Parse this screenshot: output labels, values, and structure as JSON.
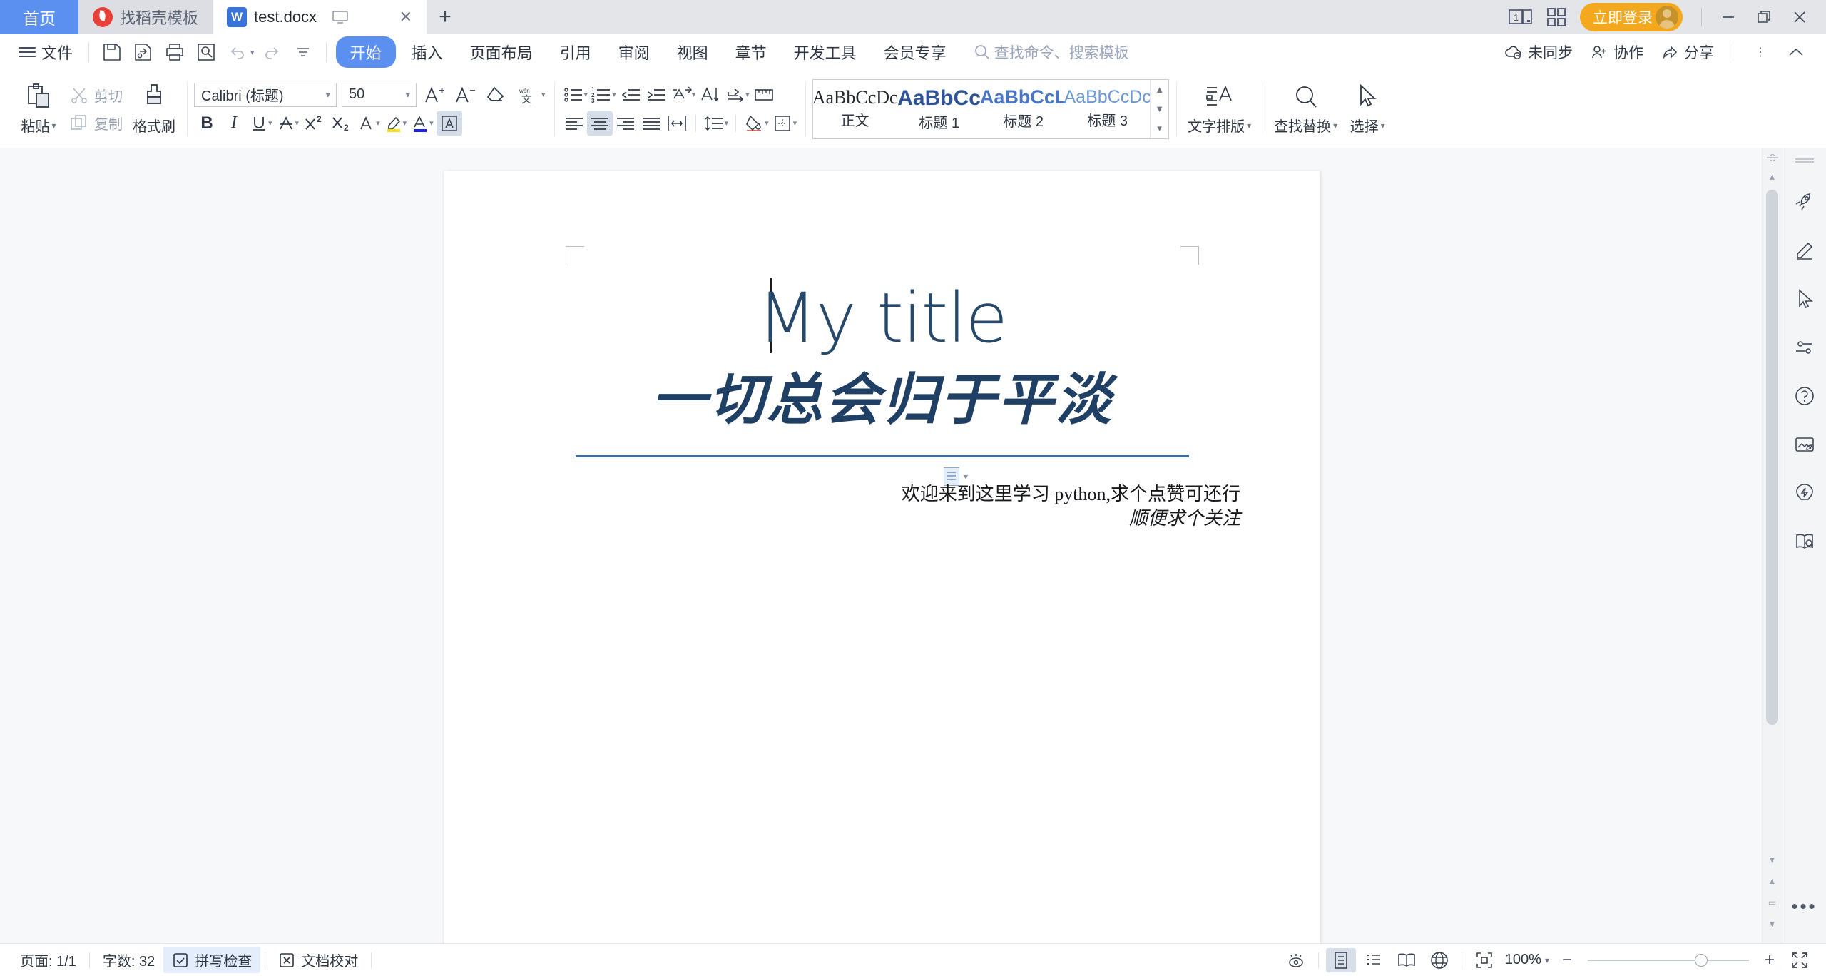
{
  "window": {
    "tabs": [
      {
        "label": "首页",
        "icon": "home-tab",
        "type": "home"
      },
      {
        "label": "找稻壳模板",
        "icon": "daoke-icon",
        "type": "inactive"
      },
      {
        "label": "test.docx",
        "icon": "wps-writer-icon",
        "type": "active"
      }
    ],
    "new_tab_label": "+",
    "close_label": "✕",
    "login_label": "立即登录",
    "minimize_label": "—",
    "restore_label": "❐",
    "close_window_label": "✕"
  },
  "menubar": {
    "file_label": "文件",
    "quick_icons": [
      "save-icon",
      "save-as-icon",
      "print-icon",
      "print-preview-icon",
      "undo-icon",
      "redo-icon",
      "customize-icon"
    ],
    "tabs": [
      {
        "label": "开始",
        "active": true
      },
      {
        "label": "插入",
        "active": false
      },
      {
        "label": "页面布局",
        "active": false
      },
      {
        "label": "引用",
        "active": false
      },
      {
        "label": "审阅",
        "active": false
      },
      {
        "label": "视图",
        "active": false
      },
      {
        "label": "章节",
        "active": false
      },
      {
        "label": "开发工具",
        "active": false
      },
      {
        "label": "会员专享",
        "active": false
      }
    ],
    "search_placeholder": "查找命令、搜索模板",
    "right_items": [
      {
        "label": "未同步",
        "icon": "cloud-sync-icon"
      },
      {
        "label": "协作",
        "icon": "collaborate-icon"
      },
      {
        "label": "分享",
        "icon": "share-icon"
      }
    ],
    "more_label": "⋮",
    "collapse_label": "⌃"
  },
  "ribbon": {
    "clipboard": {
      "paste_label": "粘贴",
      "cut_label": "剪切",
      "copy_label": "复制",
      "format_painter_label": "格式刷"
    },
    "font": {
      "family_value": "Calibri (标题)",
      "size_value": "50",
      "grow_label": "A+",
      "shrink_label": "A−",
      "clear_format_label": "clear-format-icon",
      "phonetic_label": "拼音指南",
      "bold_label": "B",
      "italic_label": "I",
      "underline_label": "U",
      "strikethrough_label": "A",
      "superscript_label": "X²",
      "subscript_label": "X₂",
      "text_effects_label": "A",
      "highlight_label": "A",
      "font_color_label": "A",
      "char_border_label": "A"
    },
    "paragraph": {
      "bullets_label": "项目符号",
      "numbering_label": "编号",
      "decrease_indent_label": "减少缩进",
      "increase_indent_label": "增加缩进",
      "asian_layout_label": "中文版式",
      "sort_label": "排序",
      "show_marks_label": "显示/隐藏编辑标记",
      "ruler_label": "标尺",
      "align_left_label": "左对齐",
      "align_center_label": "居中对齐",
      "align_right_label": "右对齐",
      "align_justify_label": "两端对齐",
      "distribute_label": "分散对齐",
      "line_spacing_label": "行距",
      "shading_label": "底纹",
      "borders_label": "边框"
    },
    "styles": {
      "items": [
        {
          "sample": "AaBbCcDc",
          "name": "正文",
          "color": "#24292f",
          "weight": "normal",
          "family": "serif",
          "size": "25px"
        },
        {
          "sample": "AaBbCc",
          "name": "标题 1",
          "color": "#2f5496",
          "weight": "bold",
          "family": "sans",
          "size": "30px"
        },
        {
          "sample": "AaBbCcL",
          "name": "标题 2",
          "color": "#4a76c4",
          "weight": "bold",
          "family": "sans",
          "size": "27px"
        },
        {
          "sample": "AaBbCcDc",
          "name": "标题 3",
          "color": "#6d98d6",
          "weight": "normal",
          "family": "sans",
          "size": "25px"
        }
      ],
      "scroll_up": "▲",
      "scroll_down": "▼",
      "scroll_more": "▾"
    },
    "tools": [
      {
        "label": "文字排版",
        "icon": "text-layout-icon",
        "caret": true
      },
      {
        "label": "查找替换",
        "icon": "find-replace-icon",
        "caret": true
      },
      {
        "label": "选择",
        "icon": "select-cursor-icon",
        "caret": true
      }
    ]
  },
  "document": {
    "title": "My title",
    "subtitle": "一切总会归于平淡",
    "body_line_1": "欢迎来到这里学习 python,求个点赞可还行",
    "body_line_2": "顺便求个关注",
    "accent_rule_color": "#3f6d9e",
    "title_color": "#26486b"
  },
  "status": {
    "page_label": "页面: 1/1",
    "word_count_label": "字数: 32",
    "spellcheck_label": "拼写检查",
    "proofread_label": "文档校对",
    "view_icons": [
      "eye-icon",
      "print-layout-icon",
      "outline-icon",
      "reading-layout-icon",
      "web-layout-icon"
    ],
    "fit_label": "fit-page-icon",
    "zoom_label": "100%",
    "zoom_minus": "−",
    "zoom_plus": "+",
    "fullscreen_label": "fullscreen-icon"
  },
  "rail": {
    "icons": [
      "rocket-icon",
      "pen-brush-icon",
      "cursor-arrow-icon",
      "settings-sliders-icon",
      "help-circle-icon",
      "picture-leaf-icon",
      "lightning-badge-icon",
      "book-search-icon"
    ],
    "more_label": "•••"
  }
}
